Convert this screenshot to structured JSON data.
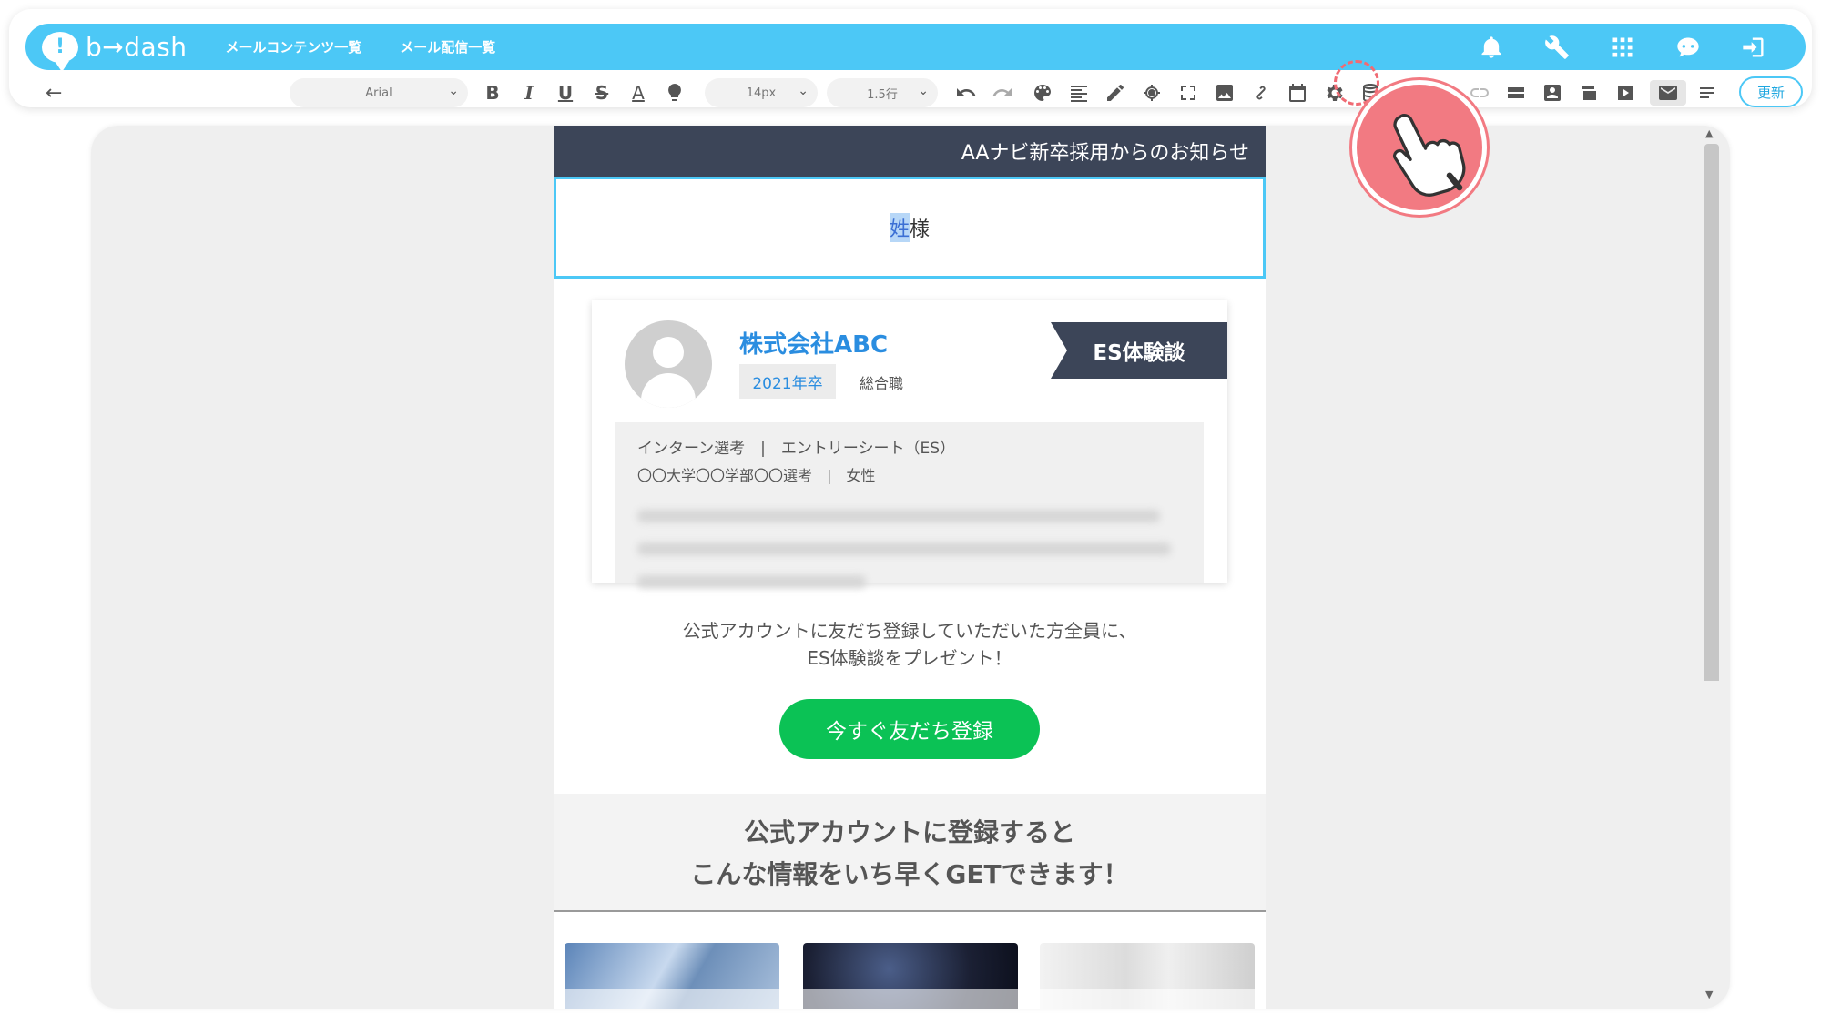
{
  "app": {
    "logo_text": "b→dash",
    "nav": [
      "メールコンテンツ一覧",
      "メール配信一覧"
    ]
  },
  "toolbar": {
    "font": "Arial",
    "font_size": "14px",
    "line_height": "1.5行",
    "update_label": "更新"
  },
  "email": {
    "header_title": "AAナビ新卒採用からのお知らせ",
    "name_selected": "姓",
    "name_rest": "様",
    "card": {
      "company": "株式会社ABC",
      "year": "2021年卒",
      "job": "総合職",
      "es_label": "ES体験談",
      "info_line1": "インターン選考　|　エントリーシート（ES）",
      "info_line2": "〇〇大学〇〇学部〇〇選考　|　女性"
    },
    "promo_line1": "公式アカウントに友だち登録していただいた方全員に、",
    "promo_line2": "ES体験談をプレゼント！",
    "cta_label": "今すぐ友だち登録",
    "section_line1": "公式アカウントに登録すると",
    "section_line2": "こんな情報をいち早くGETできます！"
  },
  "colors": {
    "brand": "#4cc8f6",
    "header_dark": "#3c4558",
    "line_green": "#0bc255",
    "pointer": "#f27a82"
  }
}
